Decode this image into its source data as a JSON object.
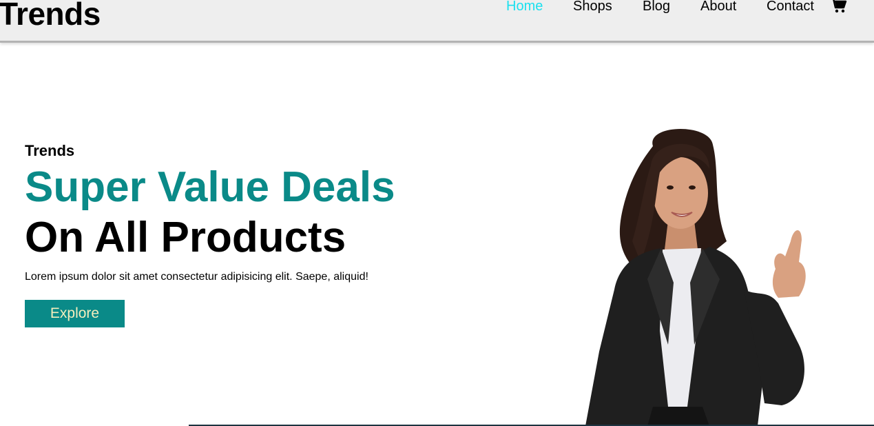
{
  "brand": {
    "logo": "Trends"
  },
  "nav": {
    "items": [
      {
        "label": "Home",
        "active": true
      },
      {
        "label": "Shops",
        "active": false
      },
      {
        "label": "Blog",
        "active": false
      },
      {
        "label": "About",
        "active": false
      },
      {
        "label": "Contact",
        "active": false
      }
    ],
    "cart_icon": "shopping-cart-icon",
    "active_color": "#1be0ee"
  },
  "hero": {
    "eyebrow": "Trends",
    "headline_1": "Super Value Deals",
    "headline_2": "On All Products",
    "description": "Lorem ipsum dolor sit amet consectetur adipisicing elit. Saepe, aliquid!",
    "cta_label": "Explore",
    "accent_color": "#0a8a88",
    "cta_text_color": "#f5eebd"
  }
}
